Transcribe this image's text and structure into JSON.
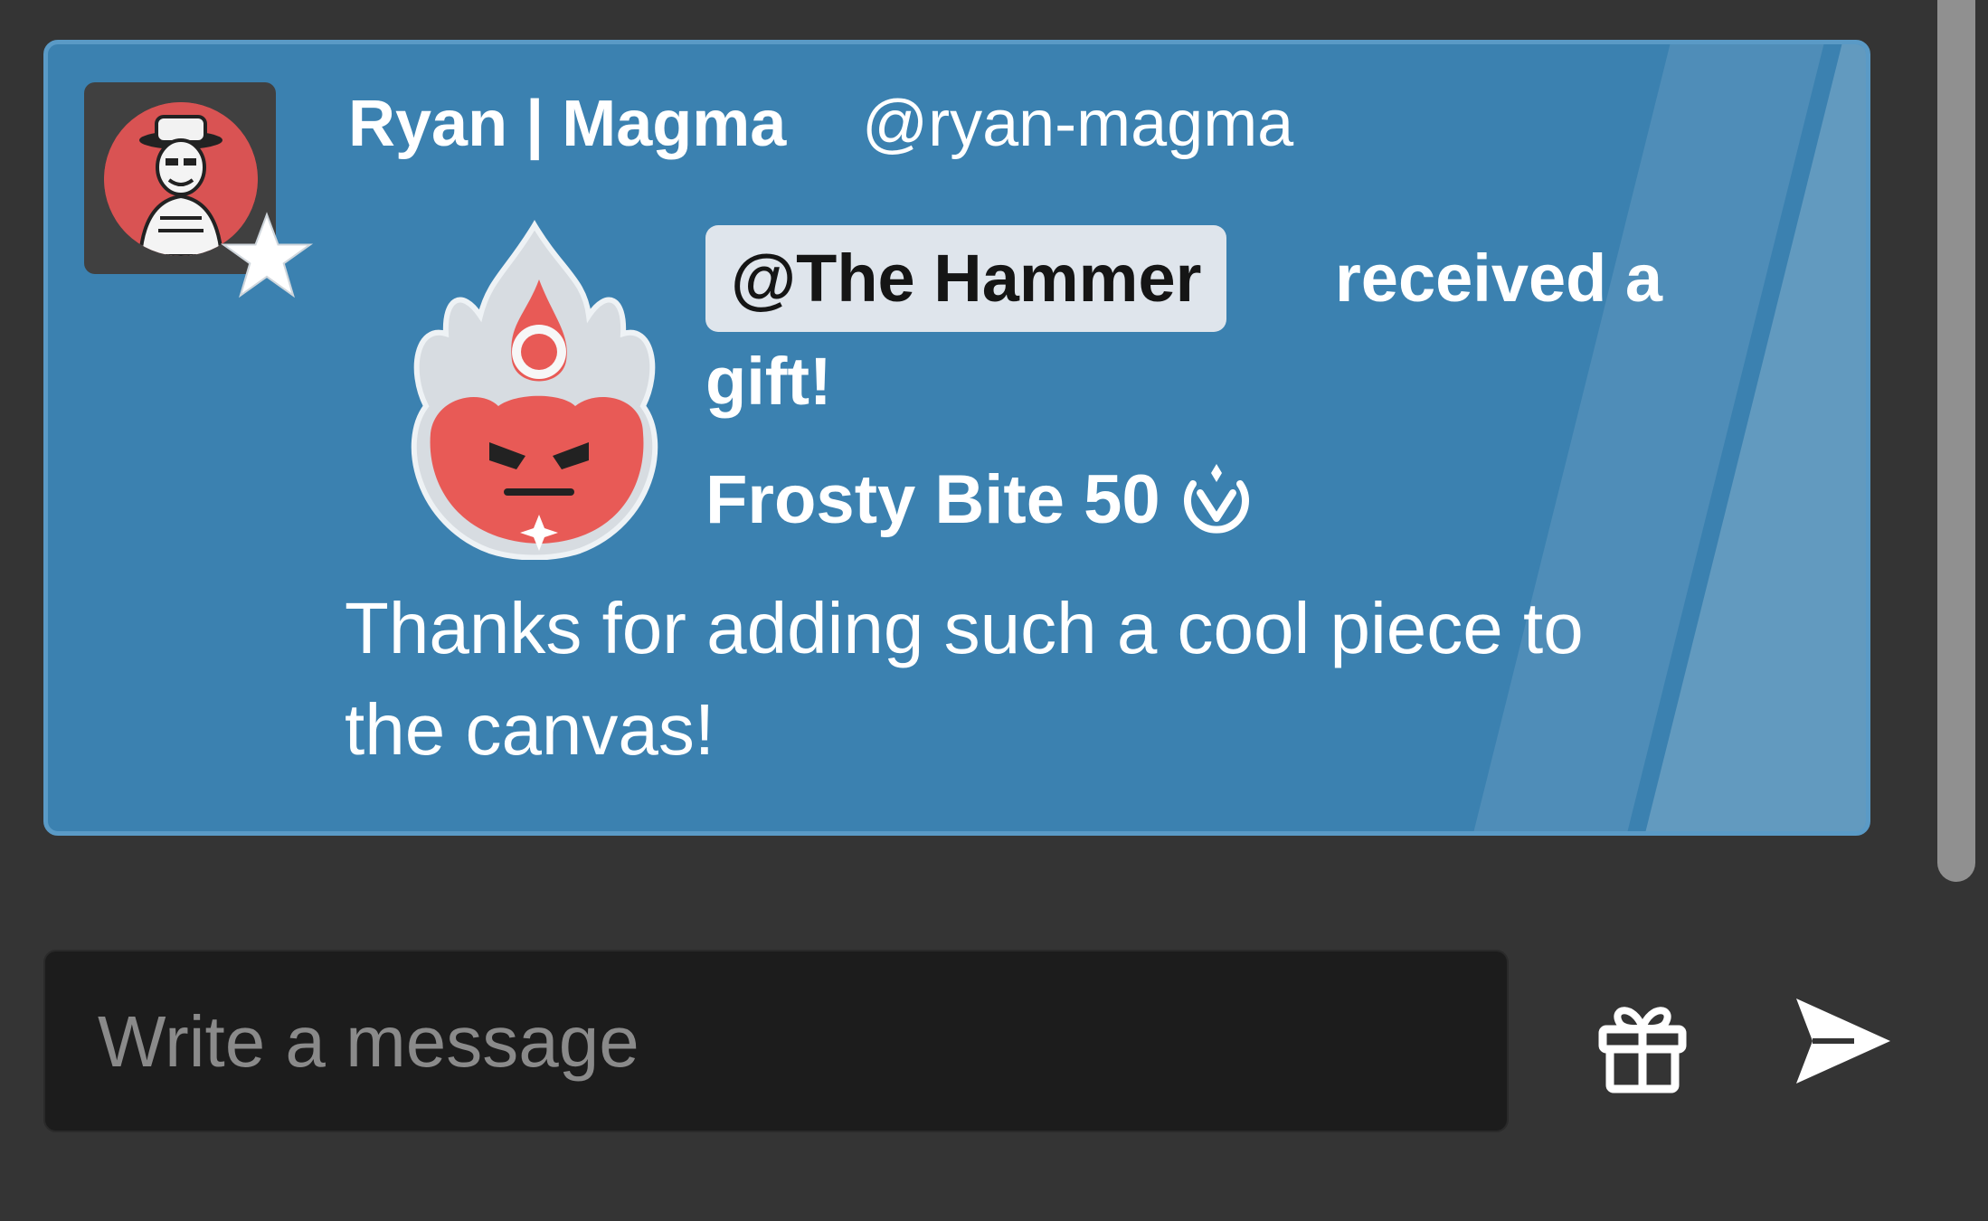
{
  "message": {
    "author": {
      "display_name": "Ryan | Magma",
      "handle": "@ryan-magma"
    },
    "gift": {
      "recipient_mention": "@The Hammer",
      "received_line1": "received a",
      "received_line2": "gift!",
      "item_name": "Frosty Bite 50"
    },
    "text_line1": "Thanks for adding such a cool piece to",
    "text_line2": "the canvas!",
    "card_color": "#3b81b0"
  },
  "composer": {
    "placeholder": "Write a message",
    "value": ""
  },
  "icons": {
    "gift": "gift-icon",
    "send": "send-icon",
    "currency": "magma-currency-icon",
    "star": "star-badge-icon"
  }
}
